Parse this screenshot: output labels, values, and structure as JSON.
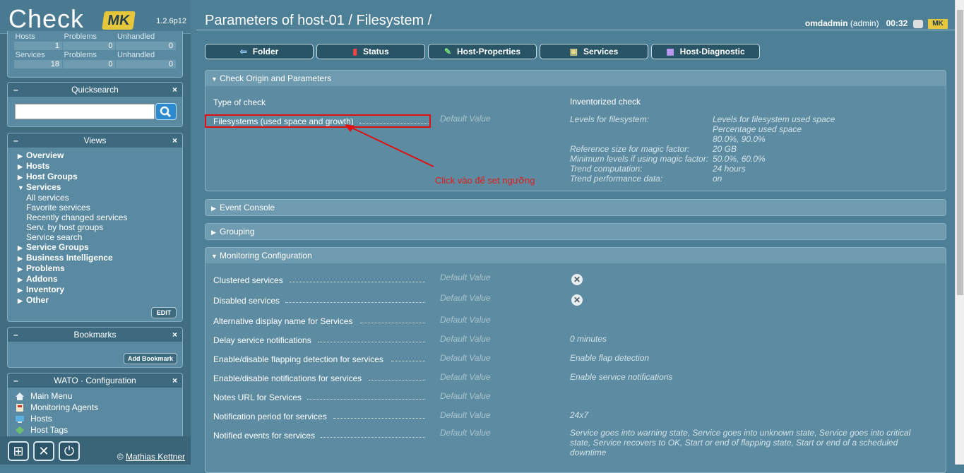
{
  "sidebar": {
    "logo_text": "Check",
    "logo_badge": "MK",
    "version": "1.2.6p12",
    "stats": {
      "hosts_label": "Hosts",
      "problems_label": "Problems",
      "unhandled_label": "Unhandled",
      "hosts_value": "1",
      "hosts_problems": "0",
      "hosts_unhandled": "0",
      "services_label": "Services",
      "services_value": "18",
      "services_problems": "0",
      "services_unhandled": "0"
    },
    "quicksearch": {
      "title": "Quicksearch",
      "placeholder": ""
    },
    "views": {
      "title": "Views",
      "items": [
        "Overview",
        "Hosts",
        "Host Groups",
        "Services"
      ],
      "services_sub": [
        "All services",
        "Favorite services",
        "Recently changed services",
        "Serv. by host groups",
        "Service search"
      ],
      "items_after": [
        "Service Groups",
        "Business Intelligence",
        "Problems",
        "Addons",
        "Inventory",
        "Other"
      ],
      "edit_label": "EDIT"
    },
    "bookmarks": {
      "title": "Bookmarks",
      "add_label": "Add Bookmark"
    },
    "wato": {
      "title": "WATO · Configuration",
      "items": [
        "Main Menu",
        "Monitoring Agents",
        "Hosts",
        "Host Tags"
      ]
    },
    "footer": {
      "copyright": "©",
      "author": "Mathias Kettner"
    }
  },
  "header": {
    "title": "Parameters of host-01 / Filesystem /",
    "user": "omdadmin",
    "role": "(admin)",
    "time": "00:32"
  },
  "tabs": [
    "Folder",
    "Status",
    "Host-Properties",
    "Services",
    "Host-Diagnostic"
  ],
  "sections": {
    "origin": {
      "title": "Check Origin and Parameters",
      "type_label": "Type of check",
      "type_value": "Inventorized check",
      "fs_label": "Filesystems (used space and growth)",
      "fs_default": "Default Value",
      "fs_params": [
        {
          "k": "Levels for filesystem:",
          "v": "Levels for filesystem used space"
        },
        {
          "k": "",
          "v": "Percentage used space"
        },
        {
          "k": "",
          "v": "80.0%, 90.0%"
        },
        {
          "k": "Reference size for magic factor:",
          "v": "20 GB"
        },
        {
          "k": "Minimum levels if using magic factor:",
          "v": "50.0%, 60.0%"
        },
        {
          "k": "Trend computation:",
          "v": "24 hours"
        },
        {
          "k": "Trend performance data:",
          "v": "on"
        }
      ]
    },
    "event_console": {
      "title": "Event Console"
    },
    "grouping": {
      "title": "Grouping"
    },
    "monitoring": {
      "title": "Monitoring Configuration",
      "rows": [
        {
          "label": "Clustered services",
          "default": "Default Value",
          "value": ""
        },
        {
          "label": "Disabled services",
          "default": "Default Value",
          "value": ""
        },
        {
          "label": "Alternative display name for Services",
          "default": "Default Value",
          "value": ""
        },
        {
          "label": "Delay service notifications",
          "default": "Default Value",
          "value": "0 minutes"
        },
        {
          "label": "Enable/disable flapping detection for services",
          "default": "Default Value",
          "value": "Enable flap detection"
        },
        {
          "label": "Enable/disable notifications for services",
          "default": "Default Value",
          "value": "Enable service notifications"
        },
        {
          "label": "Notes URL for Services",
          "default": "Default Value",
          "value": ""
        },
        {
          "label": "Notification period for services",
          "default": "Default Value",
          "value": "24x7"
        },
        {
          "label": "Notified events for services",
          "default": "Default Value",
          "value": "Service goes into warning state, Service goes into unknown state, Service goes into critical state, Service recovers to OK, Start or end of flapping state, Start or end of a scheduled downtime"
        }
      ]
    }
  },
  "annotation": {
    "text": "Click vào để set ngưỡng",
    "color": "#e31b1b"
  }
}
